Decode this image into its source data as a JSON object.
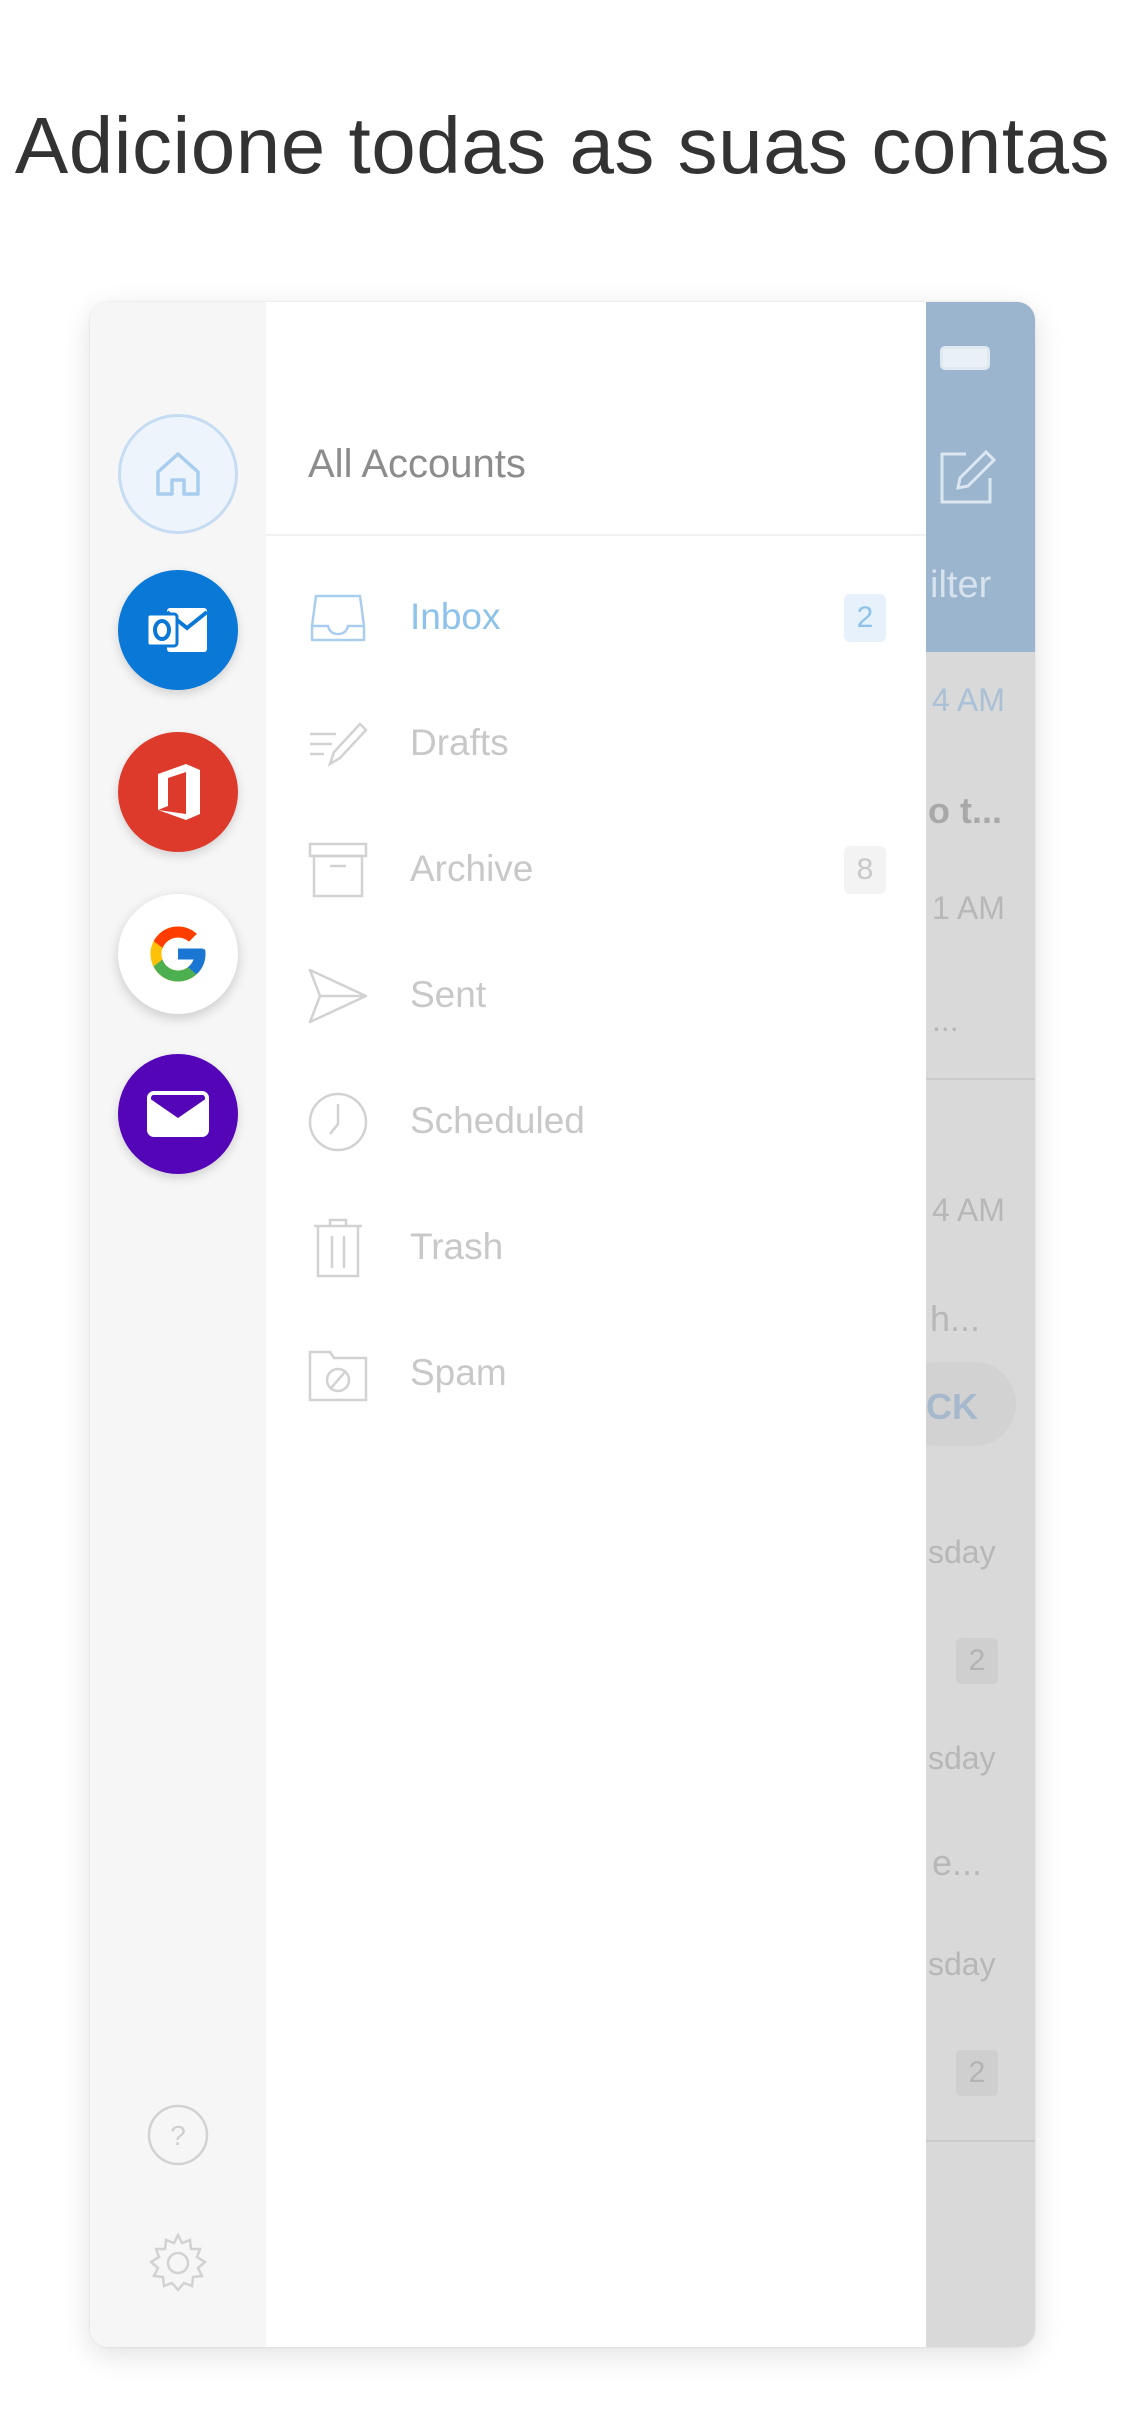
{
  "headline": "Adicione todas as suas contas",
  "accounts": [
    {
      "name": "home",
      "icon": "home-icon"
    },
    {
      "name": "outlook",
      "icon": "outlook-icon"
    },
    {
      "name": "office",
      "icon": "office-icon"
    },
    {
      "name": "google",
      "icon": "google-icon"
    },
    {
      "name": "mail",
      "icon": "mail-icon"
    }
  ],
  "panel": {
    "title": "All Accounts",
    "folders": [
      {
        "label": "Inbox",
        "badge": "2",
        "icon": "inbox-tray-icon",
        "active": true
      },
      {
        "label": "Drafts",
        "badge": "",
        "icon": "drafts-pencil-icon"
      },
      {
        "label": "Archive",
        "badge": "8",
        "icon": "archive-box-icon"
      },
      {
        "label": "Sent",
        "badge": "",
        "icon": "paper-plane-icon"
      },
      {
        "label": "Scheduled",
        "badge": "",
        "icon": "clock-icon"
      },
      {
        "label": "Trash",
        "badge": "",
        "icon": "trash-icon"
      },
      {
        "label": "Spam",
        "badge": "",
        "icon": "spam-folder-icon"
      }
    ]
  },
  "background": {
    "filter": "ilter",
    "time1": "4 AM",
    "subject1": "o t...",
    "time2": "1 AM",
    "ellipsis1": "...",
    "time3": "4 AM",
    "snippet1": "h...",
    "pill": "CK",
    "day1": "sday",
    "badge1": "2",
    "day2": "sday",
    "snippet2": "e...",
    "day3": "sday",
    "badge2": "2"
  },
  "colors": {
    "accent": "#8dc2ea",
    "outlook": "#0a78d7",
    "office": "#dd3a2c",
    "mail": "#5405b8"
  }
}
